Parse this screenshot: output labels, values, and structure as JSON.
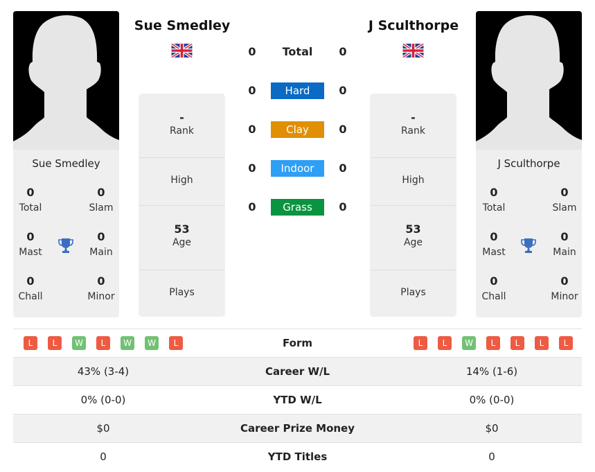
{
  "players": [
    {
      "name": "Sue Smedley",
      "country_flag": "uk-flag-icon",
      "titles": {
        "total": {
          "value": "0",
          "label": "Total"
        },
        "slam": {
          "value": "0",
          "label": "Slam"
        },
        "mast": {
          "value": "0",
          "label": "Mast"
        },
        "main": {
          "value": "0",
          "label": "Main"
        },
        "chall": {
          "value": "0",
          "label": "Chall"
        },
        "minor": {
          "value": "0",
          "label": "Minor"
        }
      },
      "info": {
        "rank": {
          "value": "-",
          "label": "Rank"
        },
        "high": {
          "value": "",
          "label": "High"
        },
        "age": {
          "value": "53",
          "label": "Age"
        },
        "plays": {
          "value": "",
          "label": "Plays"
        }
      },
      "form": [
        "L",
        "L",
        "W",
        "L",
        "W",
        "W",
        "L"
      ],
      "career_wl": "43% (3-4)",
      "ytd_wl": "0% (0-0)",
      "career_prize": "$0",
      "ytd_titles": "0"
    },
    {
      "name": "J Sculthorpe",
      "country_flag": "uk-flag-icon",
      "titles": {
        "total": {
          "value": "0",
          "label": "Total"
        },
        "slam": {
          "value": "0",
          "label": "Slam"
        },
        "mast": {
          "value": "0",
          "label": "Mast"
        },
        "main": {
          "value": "0",
          "label": "Main"
        },
        "chall": {
          "value": "0",
          "label": "Chall"
        },
        "minor": {
          "value": "0",
          "label": "Minor"
        }
      },
      "info": {
        "rank": {
          "value": "-",
          "label": "Rank"
        },
        "high": {
          "value": "",
          "label": "High"
        },
        "age": {
          "value": "53",
          "label": "Age"
        },
        "plays": {
          "value": "",
          "label": "Plays"
        }
      },
      "form": [
        "L",
        "L",
        "W",
        "L",
        "L",
        "L",
        "L"
      ],
      "career_wl": "14% (1-6)",
      "ytd_wl": "0% (0-0)",
      "career_prize": "$0",
      "ytd_titles": "0"
    }
  ],
  "h2h": [
    {
      "label": "Total",
      "left": "0",
      "right": "0",
      "color": ""
    },
    {
      "label": "Hard",
      "left": "0",
      "right": "0",
      "color": "#0a6ac4"
    },
    {
      "label": "Clay",
      "left": "0",
      "right": "0",
      "color": "#e08f07"
    },
    {
      "label": "Indoor",
      "left": "0",
      "right": "0",
      "color": "#2d9ff5"
    },
    {
      "label": "Grass",
      "left": "0",
      "right": "0",
      "color": "#0b9440"
    }
  ],
  "stats_labels": {
    "form": "Form",
    "career_wl": "Career W/L",
    "ytd_wl": "YTD W/L",
    "career_prize": "Career Prize Money",
    "ytd_titles": "YTD Titles"
  },
  "colors": {
    "loss": "#ee5b43",
    "win": "#72c173",
    "trophy": "#3a6fbf"
  }
}
